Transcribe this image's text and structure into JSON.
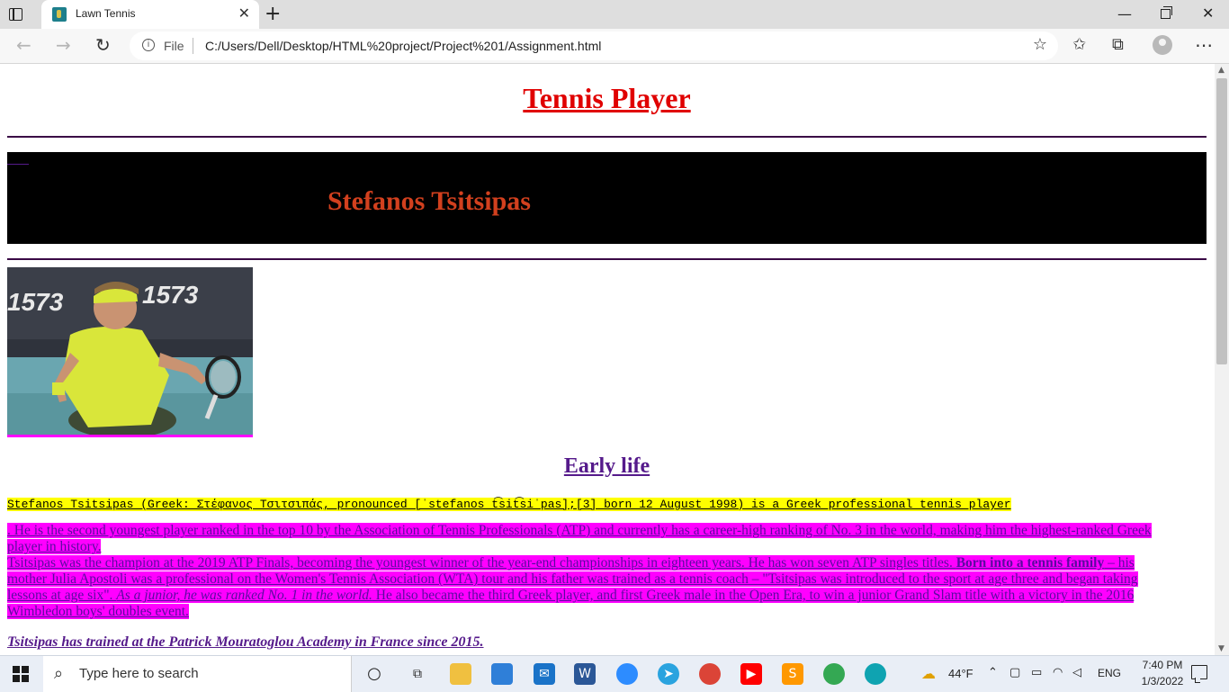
{
  "browser": {
    "tab_title": "Lawn Tennis",
    "tab_close": "✕",
    "new_tab": "+",
    "address_scheme": "File",
    "address_url": "C:/Users/Dell/Desktop/HTML%20project/Project%201/Assignment.html",
    "icons": [
      "tab-actions-icon",
      "favicon-icon",
      "close-icon",
      "new-tab-icon",
      "minimize-icon",
      "maximize-icon",
      "window-close-icon",
      "back-icon",
      "forward-icon",
      "reload-icon",
      "info-icon",
      "add-favorite-icon",
      "favorites-icon",
      "collections-icon",
      "profile-icon",
      "more-icon"
    ]
  },
  "page": {
    "title": "Tennis Player",
    "player_name": "Stefanos Tsitsipas",
    "section_heading": "Early life",
    "intro": "Stefanos Tsitsipas (Greek: Στέφανος Τσιτσιπάς, pronounced [ˈstefanos t͡sit͡siˈpas];[3] born 12 August 1998) is a Greek professional tennis player",
    "para1": ". He is the second youngest player ranked in the top 10 by the Association of Tennis Professionals (ATP) and currently has a career-high ranking of No. 3 in the world, making him the highest-ranked Greek player in history.",
    "para2_a": "Tsitsipas was the champion at the 2019 ATP Finals, becoming the youngest winner of the year-end championships in eighteen years. He has won seven ATP singles titles. ",
    "para2_bold": "Born into a tennis family",
    "para2_b": " – his mother Julia Apostoli was a professional on the Women's Tennis Association (WTA) tour and his father was trained as a tennis coach – \"Tsitsipas was introduced to the sport at age three and began taking lessons at age six\". ",
    "para2_italic": "As a junior, he was ranked No. 1 in the world.",
    "para2_c": " He also became the third Greek player, and first Greek male in the Open Era, to win a junior Grand Slam title with a victory in the 2016 Wimbledon boys' doubles event.",
    "trained": "Tsitsipas has trained at the Patrick Mouratoglou Academy in France since 2015.",
    "colors": {
      "title": "#e00000",
      "player_name": "#d2401e",
      "banner": "#000000",
      "highlight_yellow": "#ffff00",
      "highlight_magenta": "#ff00ff",
      "link_purple": "#551a8b"
    }
  },
  "taskbar": {
    "search_placeholder": "Type here to search",
    "temperature": "44°F",
    "language": "ENG",
    "time": "7:40 PM",
    "date": "1/3/2022",
    "apps": [
      "cortana-icon",
      "task-view-icon",
      "file-explorer-icon",
      "store-icon",
      "mail-icon",
      "word-icon",
      "zoom-icon",
      "telegram-icon",
      "chrome-icon",
      "youtube-icon",
      "sublime-icon",
      "chrome-alt-icon",
      "edge-icon"
    ]
  }
}
